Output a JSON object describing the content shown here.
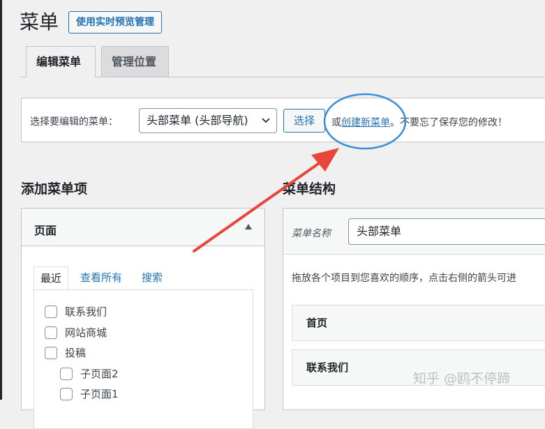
{
  "header": {
    "title": "菜单",
    "live_preview_button": "使用实时预览管理"
  },
  "tabs": [
    {
      "label": "编辑菜单",
      "active": true
    },
    {
      "label": "管理位置",
      "active": false
    }
  ],
  "manage": {
    "select_label": "选择要编辑的菜单：",
    "selected_menu": "头部菜单 (头部导航)",
    "select_button": "选择",
    "or_text": "或",
    "create_link": "创建新菜单",
    "period": "。",
    "reminder": "不要忘了保存您的修改！"
  },
  "add_items": {
    "heading": "添加菜单项",
    "panel_title": "页面",
    "subtabs": [
      "最近",
      "查看所有",
      "搜索"
    ],
    "pages": [
      {
        "label": "联系我们",
        "level": 0
      },
      {
        "label": "网站商城",
        "level": 0
      },
      {
        "label": "投稿",
        "level": 0
      },
      {
        "label": "子页面2",
        "level": 1
      },
      {
        "label": "子页面1",
        "level": 1
      }
    ]
  },
  "structure": {
    "heading": "菜单结构",
    "name_label": "菜单名称",
    "name_value": "头部菜单",
    "hint": "拖放各个项目到您喜欢的顺序，点击右侧的箭头可进",
    "items": [
      "首页",
      "联系我们"
    ]
  },
  "watermark": "知乎 @鸥不停蹄",
  "colors": {
    "accent": "#2271b1",
    "annotation_circle": "#3b8fd9",
    "annotation_arrow": "#e8463a"
  }
}
